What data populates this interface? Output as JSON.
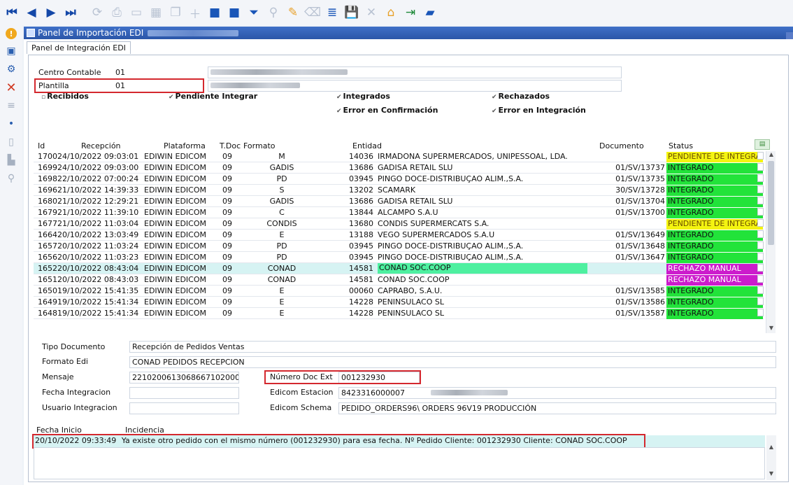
{
  "toolbar": {
    "icons": [
      "first-icon",
      "prev-icon",
      "next-icon",
      "last-icon",
      "refresh-icon",
      "print-icon",
      "preview-icon",
      "grid-icon",
      "copy-icon",
      "add-icon",
      "save-form-icon",
      "open-icon",
      "filter-icon",
      "search-icon",
      "edit-icon",
      "clear-icon",
      "export-icon",
      "save-icon",
      "delete-icon",
      "home-icon",
      "exit-icon",
      "clipboard-icon"
    ]
  },
  "window": {
    "title": "Panel de Importación EDI"
  },
  "tabs": [
    "Panel de Integración EDI"
  ],
  "form": {
    "centro_label": "Centro Contable",
    "centro_value": "01",
    "plantilla_label": "Plantilla",
    "plantilla_value": "01"
  },
  "filters": {
    "recibidos": "Recibidos",
    "pendiente": "Pendiente Integrar",
    "integrados": "Integrados",
    "rechazados": "Rechazados",
    "error_conf": "Error en Confirmación",
    "error_int": "Error en Integración"
  },
  "table": {
    "headers": {
      "id": "Id",
      "recepcion": "Recepción",
      "plataforma": "Plataforma",
      "tdoc": "T.Doc",
      "formato": "Formato",
      "entidad": "Entidad",
      "documento": "Documento",
      "status": "Status"
    },
    "rows": [
      {
        "id": "1700",
        "recepcion": "24/10/2022 09:03:01",
        "plataforma": "EDIWIN EDICOM",
        "tdoc": "09",
        "formato": "M",
        "entidad": "14036",
        "nombre": "IRMADONA SUPERMERCADOS, UNIPESSOAL, LDA.",
        "documento": "",
        "status": "PENDIENTE DE INTEGRA",
        "status_type": "pend"
      },
      {
        "id": "1699",
        "recepcion": "24/10/2022 09:03:00",
        "plataforma": "EDIWIN EDICOM",
        "tdoc": "09",
        "formato": "GADIS",
        "entidad": "13686",
        "nombre": "GADISA RETAIL SLU",
        "documento": "01/SV/13737",
        "status": "INTEGRADO",
        "status_type": "int"
      },
      {
        "id": "1698",
        "recepcion": "22/10/2022 07:00:24",
        "plataforma": "EDIWIN EDICOM",
        "tdoc": "09",
        "formato": "PD",
        "entidad": "03945",
        "nombre": "PINGO DOCE-DISTRIBUÇAO ALIM.,S.A.",
        "documento": "01/SV/13735",
        "status": "INTEGRADO",
        "status_type": "int"
      },
      {
        "id": "1696",
        "recepcion": "21/10/2022 14:39:33",
        "plataforma": "EDIWIN EDICOM",
        "tdoc": "09",
        "formato": "S",
        "entidad": "13202",
        "nombre": "SCAMARK",
        "documento": "30/SV/13728",
        "status": "INTEGRADO",
        "status_type": "int"
      },
      {
        "id": "1680",
        "recepcion": "21/10/2022 12:29:21",
        "plataforma": "EDIWIN EDICOM",
        "tdoc": "09",
        "formato": "GADIS",
        "entidad": "13686",
        "nombre": "GADISA RETAIL SLU",
        "documento": "01/SV/13704",
        "status": "INTEGRADO",
        "status_type": "int"
      },
      {
        "id": "1679",
        "recepcion": "21/10/2022 11:39:10",
        "plataforma": "EDIWIN EDICOM",
        "tdoc": "09",
        "formato": "C",
        "entidad": "13844",
        "nombre": "ALCAMPO S.A.U",
        "documento": "01/SV/13700",
        "status": "INTEGRADO",
        "status_type": "int"
      },
      {
        "id": "1677",
        "recepcion": "21/10/2022 11:03:04",
        "plataforma": "EDIWIN EDICOM",
        "tdoc": "09",
        "formato": "CONDIS",
        "entidad": "13680",
        "nombre": "CONDIS SUPERMERCATS S.A.",
        "documento": "",
        "status": "PENDIENTE DE INTEGRA",
        "status_type": "pend"
      },
      {
        "id": "1664",
        "recepcion": "20/10/2022 13:03:49",
        "plataforma": "EDIWIN EDICOM",
        "tdoc": "09",
        "formato": "E",
        "entidad": "13188",
        "nombre": "VEGO SUPERMERCADOS S.A.U",
        "documento": "01/SV/13649",
        "status": "INTEGRADO",
        "status_type": "int"
      },
      {
        "id": "1657",
        "recepcion": "20/10/2022 11:03:24",
        "plataforma": "EDIWIN EDICOM",
        "tdoc": "09",
        "formato": "PD",
        "entidad": "03945",
        "nombre": "PINGO DOCE-DISTRIBUÇAO ALIM.,S.A.",
        "documento": "01/SV/13648",
        "status": "INTEGRADO",
        "status_type": "int"
      },
      {
        "id": "1656",
        "recepcion": "20/10/2022 11:03:23",
        "plataforma": "EDIWIN EDICOM",
        "tdoc": "09",
        "formato": "PD",
        "entidad": "03945",
        "nombre": "PINGO DOCE-DISTRIBUÇAO ALIM.,S.A.",
        "documento": "01/SV/13647",
        "status": "INTEGRADO",
        "status_type": "int"
      },
      {
        "id": "1652",
        "recepcion": "20/10/2022 08:43:04",
        "plataforma": "EDIWIN EDICOM",
        "tdoc": "09",
        "formato": "CONAD",
        "entidad": "14581",
        "nombre": "CONAD SOC.COOP",
        "documento": "",
        "status": "RECHAZO MANUAL",
        "status_type": "rech",
        "selected": true
      },
      {
        "id": "1651",
        "recepcion": "20/10/2022 08:43:03",
        "plataforma": "EDIWIN EDICOM",
        "tdoc": "09",
        "formato": "CONAD",
        "entidad": "14581",
        "nombre": "CONAD SOC.COOP",
        "documento": "",
        "status": "RECHAZO MANUAL",
        "status_type": "rech"
      },
      {
        "id": "1650",
        "recepcion": "19/10/2022 15:41:35",
        "plataforma": "EDIWIN EDICOM",
        "tdoc": "09",
        "formato": "E",
        "entidad": "00060",
        "nombre": "CAPRABO, S.A.U.",
        "documento": "01/SV/13585",
        "status": "INTEGRADO",
        "status_type": "int"
      },
      {
        "id": "1649",
        "recepcion": "19/10/2022 15:41:34",
        "plataforma": "EDIWIN EDICOM",
        "tdoc": "09",
        "formato": "E",
        "entidad": "14228",
        "nombre": "PENINSULACO SL",
        "documento": "01/SV/13586",
        "status": "INTEGRADO",
        "status_type": "int"
      },
      {
        "id": "1648",
        "recepcion": "19/10/2022 15:41:34",
        "plataforma": "EDIWIN EDICOM",
        "tdoc": "09",
        "formato": "E",
        "entidad": "14228",
        "nombre": "PENINSULACO SL",
        "documento": "01/SV/13587",
        "status": "INTEGRADO",
        "status_type": "int"
      }
    ]
  },
  "detail": {
    "tipo_doc_label": "Tipo Documento",
    "tipo_doc_value": "Recepción de Pedidos Ventas",
    "formato_label": "Formato Edi",
    "formato_value": "CONAD PEDIDOS RECEPCION",
    "mensaje_label": "Mensaje",
    "mensaje_value": "2210200613068667102000",
    "fecha_int_label": "Fecha Integracion",
    "usuario_int_label": "Usuario Integracion",
    "num_doc_label": "Número Doc Ext",
    "num_doc_value": "001232930",
    "edicom_estacion_label": "Edicom Estacion",
    "edicom_estacion_value": "8423316000007",
    "edicom_schema_label": "Edicom Schema",
    "edicom_schema_value": "PEDIDO_ORDERS96\\ ORDERS 96V19 PRODUCCIÓN"
  },
  "log": {
    "fecha_label": "Fecha Inicio",
    "incidencia_label": "Incidencia",
    "fecha_value": "20/10/2022 09:33:49",
    "incidencia_value": "Ya existe otro pedido con el mismo número (001232930) para esa fecha.  Nº Pedido Cliente: 001232930 Cliente: CONAD SOC.COOP"
  },
  "colors": {
    "integrado": "#22e33a",
    "pendiente": "#f4f410",
    "rechazo": "#cc1ccc",
    "selected_row": "#d6f3f3",
    "highlight_box": "#d4282e",
    "titlebar": "#2b56a8"
  }
}
